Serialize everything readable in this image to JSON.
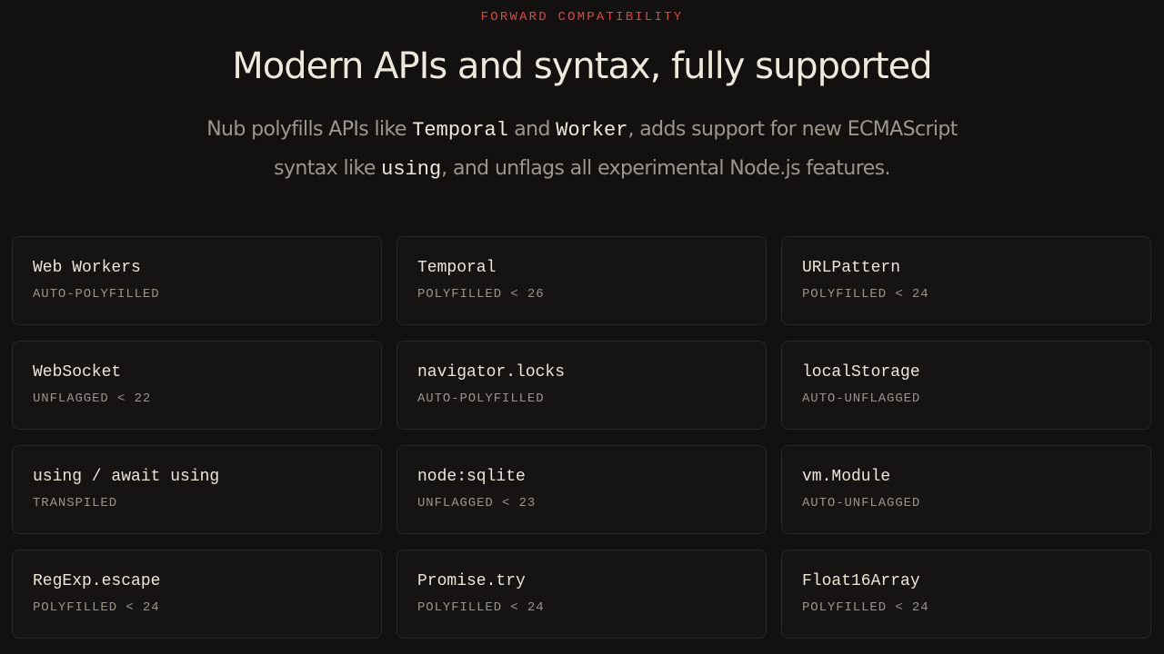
{
  "header": {
    "eyebrow": "FORWARD COMPATIBILITY",
    "title": "Modern APIs and syntax, fully supported",
    "lede": {
      "t1": "Nub polyfills APIs like ",
      "c1": "Temporal",
      "t2": " and ",
      "c2": "Worker",
      "t3": ", adds support for new ECMAScript syntax like ",
      "c3": "using",
      "t4": ", and unflags all experimental Node.js features."
    }
  },
  "features": [
    {
      "name": "Web Workers",
      "status": "AUTO-POLYFILLED"
    },
    {
      "name": "Temporal",
      "status": "POLYFILLED < 26"
    },
    {
      "name": "URLPattern",
      "status": "POLYFILLED < 24"
    },
    {
      "name": "WebSocket",
      "status": "UNFLAGGED < 22"
    },
    {
      "name": "navigator.locks",
      "status": "AUTO-POLYFILLED"
    },
    {
      "name": "localStorage",
      "status": "AUTO-UNFLAGGED"
    },
    {
      "name": "using / await using",
      "status": "TRANSPILED"
    },
    {
      "name": "node:sqlite",
      "status": "UNFLAGGED < 23"
    },
    {
      "name": "vm.Module",
      "status": "AUTO-UNFLAGGED"
    },
    {
      "name": "RegExp.escape",
      "status": "POLYFILLED < 24"
    },
    {
      "name": "Promise.try",
      "status": "POLYFILLED < 24"
    },
    {
      "name": "Float16Array",
      "status": "POLYFILLED < 24"
    }
  ],
  "colors": {
    "accent": "#e2453c",
    "background": "#121110",
    "text": "#ece6d8",
    "muted": "#9a9488"
  }
}
